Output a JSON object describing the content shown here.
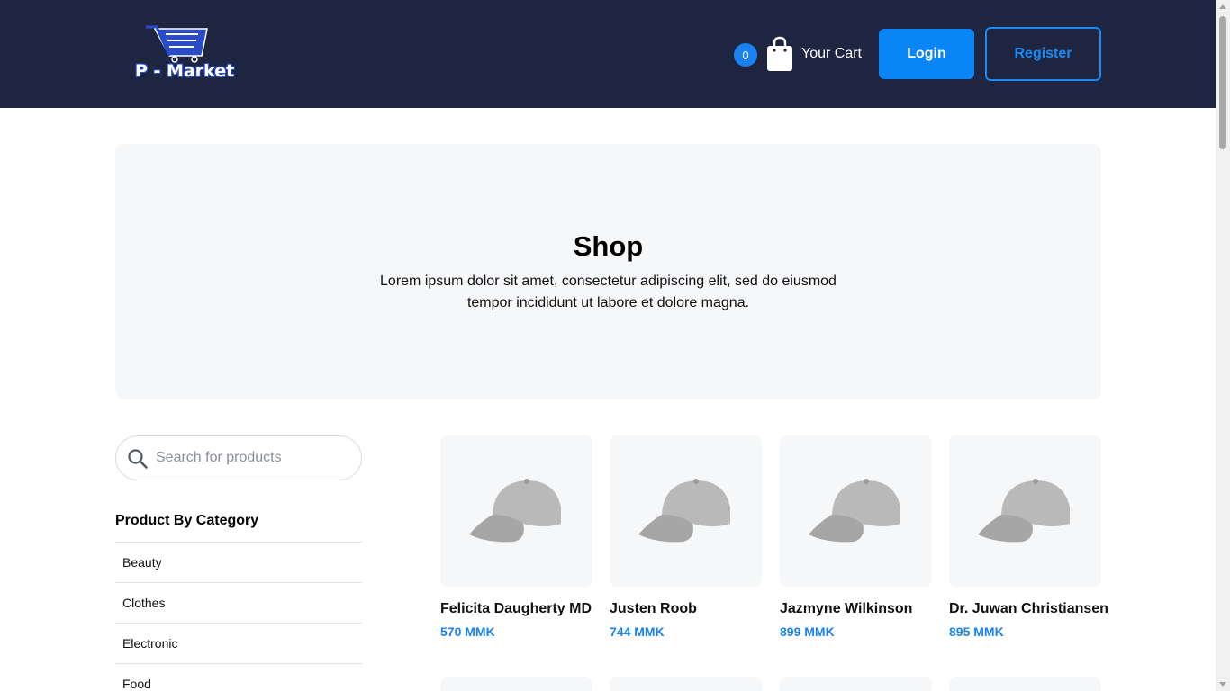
{
  "header": {
    "logo_text": "P - Market",
    "logo_icon": "shopping-cart-logo",
    "cart_count": "0",
    "cart_label": "Your Cart",
    "cart_icon": "shopping-bag-icon",
    "login_label": "Login",
    "register_label": "Register",
    "background_color": "#1e2541",
    "accent_color": "#0a85f5"
  },
  "hero": {
    "title": "Shop",
    "description": "Lorem ipsum dolor sit amet, consectetur adipiscing elit, sed do eiusmod tempor incididunt ut labore et dolore magna."
  },
  "sidebar": {
    "search_placeholder": "Search for products",
    "search_icon": "search-icon",
    "category_title": "Product By Category",
    "categories": [
      "Beauty",
      "Clothes",
      "Electronic",
      "Food"
    ]
  },
  "products": [
    {
      "name": "Felicita Daugherty MD",
      "price": "570 MMK",
      "image": "cap-image"
    },
    {
      "name": "Justen Roob",
      "price": "744 MMK",
      "image": "cap-image"
    },
    {
      "name": "Jazmyne Wilkinson",
      "price": "899 MMK",
      "image": "cap-image"
    },
    {
      "name": "Dr. Juwan Christiansen",
      "price": "895 MMK",
      "image": "cap-image"
    }
  ]
}
